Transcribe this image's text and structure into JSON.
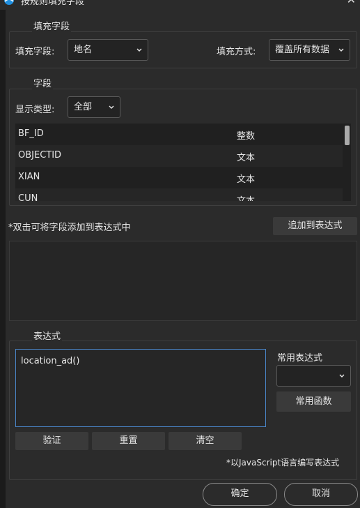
{
  "window": {
    "title": "按规则填充字段"
  },
  "fill_group": {
    "legend": "填充字段",
    "field_label": "填充字段:",
    "field_value": "地名",
    "mode_label": "填充方式:",
    "mode_value": "覆盖所有数据"
  },
  "fields_group": {
    "legend": "字段",
    "type_label": "显示类型:",
    "type_value": "全部",
    "rows": [
      {
        "name": "BF_ID",
        "type": "整数"
      },
      {
        "name": "OBJECTID",
        "type": "文本"
      },
      {
        "name": "XIAN",
        "type": "文本"
      },
      {
        "name": "CUN",
        "type": "文本"
      }
    ]
  },
  "hint": "*双击可将字段添加到表达式中",
  "add_button": "追加到表达式",
  "expression_group": {
    "legend": "表达式",
    "value": "location_ad()",
    "common_label": "常用表达式",
    "common_value": "",
    "functions_button": "常用函数",
    "verify_button": "验证",
    "reset_button": "重置",
    "clear_button": "清空",
    "note": "*以JavaScript语言编写表达式"
  },
  "ok_button": "确定",
  "cancel_button": "取消"
}
